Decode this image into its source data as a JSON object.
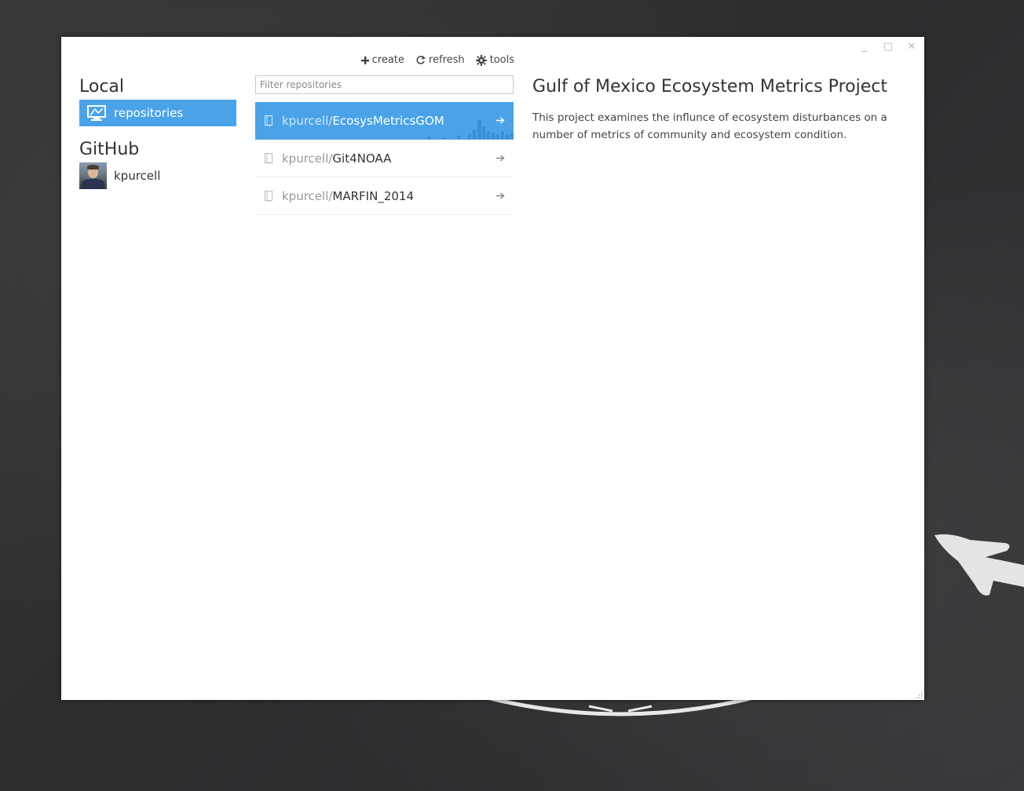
{
  "window": {
    "controls": {
      "minimize": "_",
      "maximize": "□",
      "close": "✕"
    }
  },
  "toolbar": {
    "create_label": "create",
    "refresh_label": "refresh",
    "tools_label": "tools"
  },
  "sidebar": {
    "local_title": "Local",
    "local_items": [
      {
        "label": "repositories",
        "icon": "monitor-icon",
        "selected": true
      }
    ],
    "github_title": "GitHub",
    "github_items": [
      {
        "label": "kpurcell",
        "icon": "avatar"
      }
    ]
  },
  "repos": {
    "filter_placeholder": "Filter repositories",
    "items": [
      {
        "owner": "kpurcell/",
        "name": "EcosysMetricsGOM",
        "selected": true
      },
      {
        "owner": "kpurcell/",
        "name": "Git4NOAA",
        "selected": false
      },
      {
        "owner": "kpurcell/",
        "name": "MARFIN_2014",
        "selected": false
      }
    ]
  },
  "detail": {
    "title": "Gulf of Mexico Ecosystem Metrics Project",
    "description": "This project examines the influnce of ecosystem disturbances on a number of metrics of community and ecosystem condition."
  },
  "colors": {
    "accent": "#4aa3e8",
    "desktop": "#2f3133"
  }
}
